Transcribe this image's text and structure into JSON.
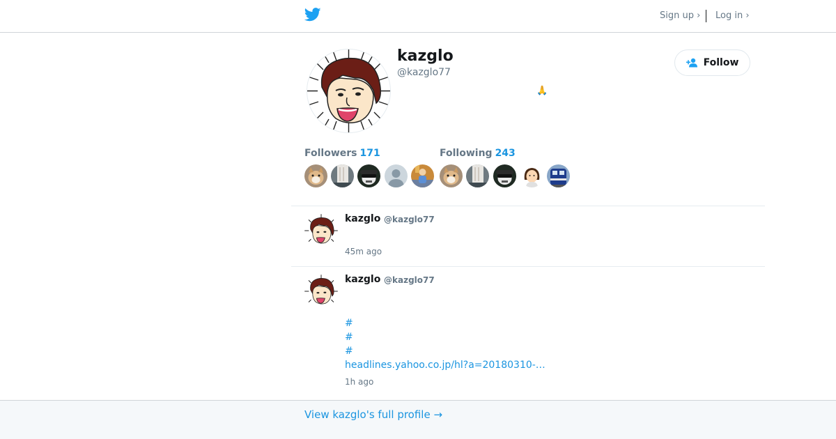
{
  "header": {
    "logo_icon": "twitter-bird-icon",
    "signup_label": "Sign up ›",
    "login_label": "Log in ›"
  },
  "profile": {
    "name": "kazglo",
    "handle": "@kazglo77",
    "bio": "🙏",
    "follow_label": "Follow",
    "followers_label": "Followers",
    "followers_count": "171",
    "following_label": "Following",
    "following_count": "243"
  },
  "followers_avatars": [
    "dog-photo",
    "cat-paw-photo",
    "masked-character",
    "default-avatar",
    "figure-photo"
  ],
  "following_avatars": [
    "dog-photo",
    "cat-paw-photo",
    "masked-character",
    "girl-emoji",
    "train-photo"
  ],
  "tweets": [
    {
      "name": "kazglo",
      "handle": "@kazglo77",
      "time": "45m ago"
    },
    {
      "name": "kazglo",
      "handle": "@kazglo77",
      "hashtags": [
        "#",
        "#",
        "#"
      ],
      "link": "headlines.yahoo.co.jp/hl?a=20180310-…",
      "time": "1h ago"
    }
  ],
  "footer": {
    "full_profile_label": "View kazglo's full profile →"
  },
  "colors": {
    "accent": "#1b95e0",
    "twitter_blue": "#1da1f2",
    "muted_text": "#657786",
    "footer_bg": "#f5f8fa"
  }
}
